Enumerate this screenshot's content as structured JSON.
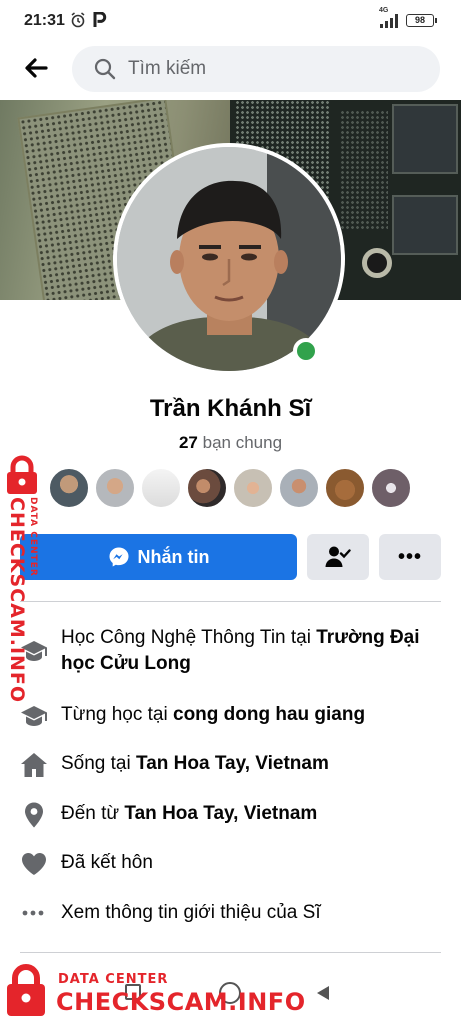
{
  "status_bar": {
    "time": "21:31",
    "network": "4G",
    "battery": "98"
  },
  "search": {
    "placeholder": "Tìm kiếm"
  },
  "profile": {
    "name": "Trần Khánh Sĩ",
    "mutual_count": "27",
    "mutual_label": "bạn chung",
    "online": true,
    "online_color": "#31a24c"
  },
  "actions": {
    "message_label": "Nhắn tin",
    "primary_color": "#1b74e4",
    "more_label": "•••"
  },
  "info": [
    {
      "icon": "graduation-cap-icon",
      "prefix": "Học Công Nghệ Thông Tin tại ",
      "bold": "Trường Đại học Cửu Long"
    },
    {
      "icon": "graduation-cap-icon",
      "prefix": "Từng học tại ",
      "bold": "cong dong hau giang"
    },
    {
      "icon": "home-icon",
      "prefix": "Sống tại ",
      "bold": "Tan Hoa Tay, Vietnam"
    },
    {
      "icon": "location-pin-icon",
      "prefix": "Đến từ ",
      "bold": "Tan Hoa Tay, Vietnam"
    },
    {
      "icon": "heart-icon",
      "prefix": "Đã kết hôn",
      "bold": ""
    },
    {
      "icon": "more-dots-icon",
      "prefix": "Xem thông tin giới thiệu của Sĩ",
      "bold": ""
    }
  ],
  "watermark": {
    "small": "DATA CENTER",
    "main": "CHECKSCAM.INFO",
    "color": "#e4252b"
  }
}
